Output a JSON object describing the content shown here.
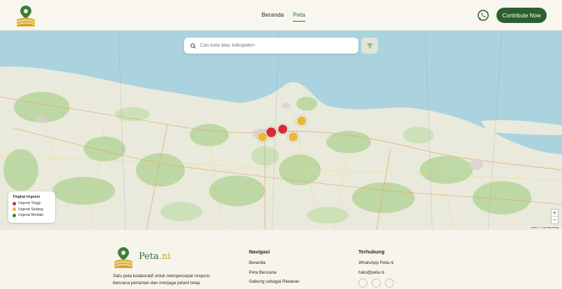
{
  "nav": {
    "items": [
      {
        "label": "Beranda"
      },
      {
        "label": "Peta"
      }
    ],
    "active": "Peta"
  },
  "header": {
    "cta_label": "Contribute Now"
  },
  "search": {
    "placeholder": "Cari kota atau kabupaten"
  },
  "legend": {
    "title": "Tingkat Urgensi",
    "items": [
      {
        "label": "Urgensi Tinggi",
        "color": "#d32f2f"
      },
      {
        "label": "Urgensi Sedang",
        "color": "#e8b83a"
      },
      {
        "label": "Urgensi Rendah",
        "color": "#3e7d3a"
      }
    ]
  },
  "map": {
    "zoom_in": "+",
    "zoom_out": "−",
    "attribution": "Leaflet | © OpenStreetMap",
    "colors": {
      "sea": "#aad3df",
      "land": "#e9eadb",
      "forest": "#b9d7a0"
    },
    "markers": [
      {
        "level": "high"
      },
      {
        "level": "high"
      },
      {
        "level": "medium"
      },
      {
        "level": "medium"
      },
      {
        "level": "medium"
      }
    ]
  },
  "footer": {
    "brand_main": "Peta",
    "brand_suffix": ".ni",
    "tagline": "Satu peta kolaboratif untuk mempercepat respons bencana pertanian dan menjaga petani tetap",
    "nav_title": "Navigasi",
    "nav_links": [
      "Beranda",
      "Peta Bencana",
      "Gabung sebagai Relawan"
    ],
    "contact_title": "Terhubung",
    "contact_links": [
      "WhatsApp Peta.ni",
      "halo@peta.ni"
    ]
  },
  "colors": {
    "primary": "#2d5f2e",
    "accent": "#c9a227",
    "background": "#f7f4ec"
  }
}
